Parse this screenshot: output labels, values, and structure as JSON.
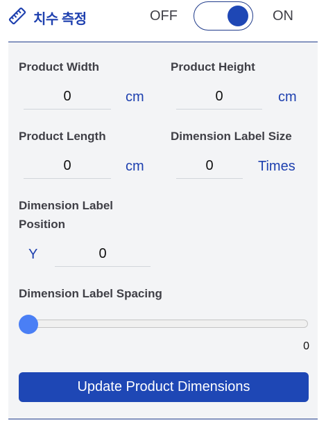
{
  "header": {
    "title": "치수 측정",
    "toggle": {
      "off_label": "OFF",
      "on_label": "ON",
      "state": "on"
    },
    "icon": "ruler-icon"
  },
  "form": {
    "width": {
      "label": "Product Width",
      "value": "0",
      "unit": "cm"
    },
    "height": {
      "label": "Product Height",
      "value": "0",
      "unit": "cm"
    },
    "length": {
      "label": "Product Length",
      "value": "0",
      "unit": "cm"
    },
    "label_size": {
      "label": "Dimension Label Size",
      "value": "0",
      "unit": "Times"
    },
    "label_position": {
      "label_line1": "Dimension Label",
      "label_line2": "Position",
      "axis": "Y",
      "value": "0"
    },
    "label_spacing": {
      "label": "Dimension Label Spacing",
      "value": "0",
      "fraction": 0
    }
  },
  "button": {
    "label": "Update Product Dimensions"
  },
  "colors": {
    "accent": "#1e47b5",
    "title": "#1e40af",
    "slider_thumb": "#4a7ff5",
    "panel_bg": "#f3f4f6"
  }
}
